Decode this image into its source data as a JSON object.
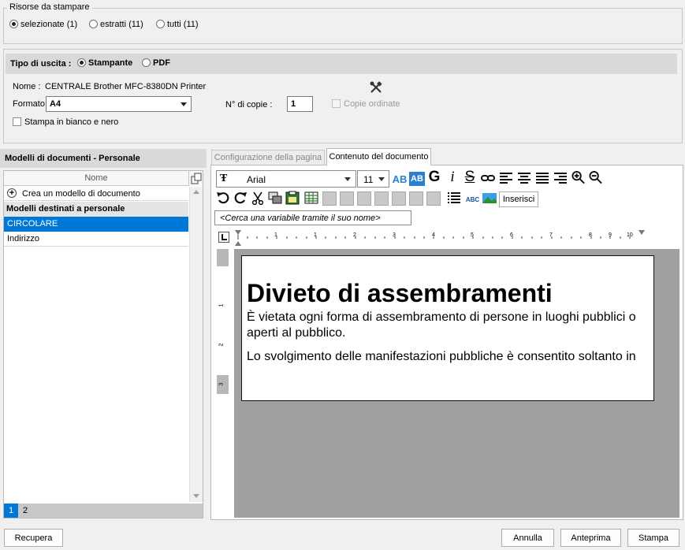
{
  "risorse": {
    "legend": "Risorse da stampare",
    "options": [
      {
        "label": "selezionate (1)",
        "selected": true
      },
      {
        "label": "estratti (11)",
        "selected": false
      },
      {
        "label": "tutti (11)",
        "selected": false
      }
    ]
  },
  "uscita": {
    "title": "Tipo di uscita :",
    "options": [
      {
        "label": "Stampante",
        "selected": true
      },
      {
        "label": "PDF",
        "selected": false
      }
    ],
    "nome_label": "Nome :",
    "nome_value": "CENTRALE Brother MFC-8380DN Printer",
    "formato_label": "Formato",
    "formato_value": "A4",
    "copie_label": "N° di copie :",
    "copie_value": "1",
    "copie_ordinate": "Copie ordinate",
    "bianco_nero": "Stampa in bianco e nero"
  },
  "modelli": {
    "title": "Modelli di documenti - Personale",
    "column": "Nome",
    "create": "Crea un modello di documento",
    "group": "Modelli destinati a personale",
    "items": [
      {
        "label": "CIRCOLARE",
        "selected": true
      },
      {
        "label": "Indirizzo",
        "selected": false
      }
    ],
    "pages": [
      "1",
      "2"
    ]
  },
  "editor": {
    "tabs": [
      {
        "label": "Configurazione della pagina",
        "active": false
      },
      {
        "label": "Contenuto del documento",
        "active": true
      }
    ],
    "font": "Arial",
    "size": "11",
    "insert_btn": "Inserisci",
    "search_placeholder": "<Cerca una variabile tramite il suo nome>",
    "ruler": [
      "1",
      "1",
      "2",
      "3",
      "4",
      "5",
      "6",
      "7",
      "8",
      "9",
      "10"
    ],
    "vruler": [
      "1",
      "2",
      "3"
    ],
    "doc_title": "Divieto di assembramenti",
    "doc_p1": "È vietata ogni forma di assembramento di persone in luoghi pubblici o aperti al pubblico.",
    "doc_p2": "Lo svolgimento delle manifestazioni pubbliche è consentito soltanto in"
  },
  "footer": {
    "recupera": "Recupera",
    "annulla": "Annulla",
    "anteprima": "Anteprima",
    "stampa": "Stampa"
  },
  "colors": {
    "selection": "#0078d7",
    "canvas": "#a0a0a0",
    "header_band": "#d9d9d9"
  }
}
